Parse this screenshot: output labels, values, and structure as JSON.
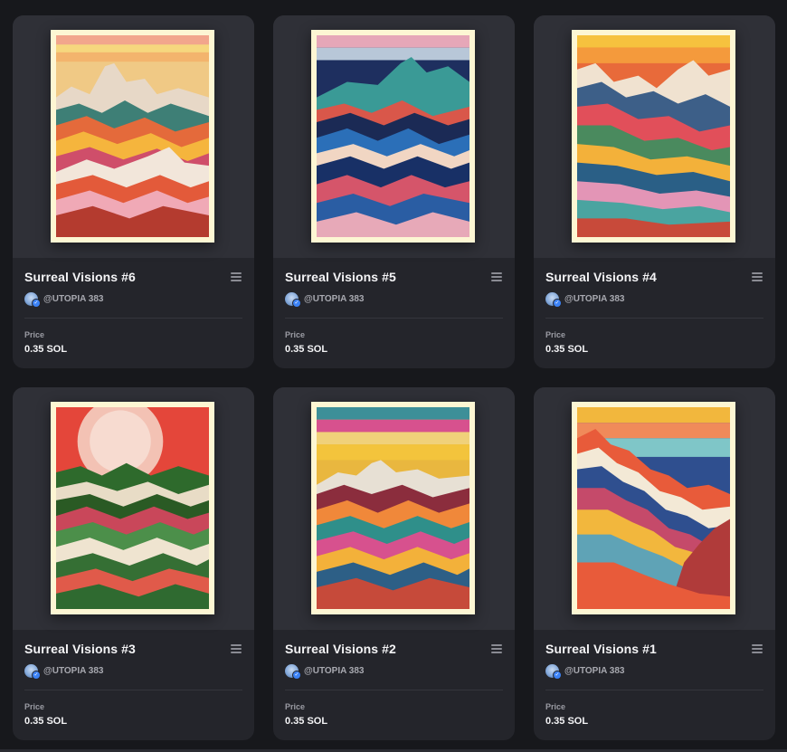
{
  "cards": [
    {
      "title": "Surreal Visions #6",
      "author": "@UTOPIA 383",
      "price_label": "Price",
      "price": "0.35 SOL",
      "palette": [
        "#f4c36b",
        "#e8593a",
        "#3f7a6a",
        "#e9a8b8",
        "#f7f0e0",
        "#243b6e"
      ]
    },
    {
      "title": "Surreal Visions #5",
      "author": "@UTOPIA 383",
      "price_label": "Price",
      "price": "0.35 SOL",
      "palette": [
        "#e9a4b6",
        "#2f8f8d",
        "#d9574a",
        "#1d3163",
        "#2a65b0",
        "#f0d7c6"
      ]
    },
    {
      "title": "Surreal Visions #4",
      "author": "@UTOPIA 383",
      "price_label": "Price",
      "price": "0.35 SOL",
      "palette": [
        "#f7b43a",
        "#e35a3a",
        "#4a8a5e",
        "#e2a0bf",
        "#2a4f80",
        "#f2e6d2"
      ]
    },
    {
      "title": "Surreal Visions #3",
      "author": "@UTOPIA 383",
      "price_label": "Price",
      "price": "0.35 SOL",
      "palette": [
        "#e7493b",
        "#f5c1b6",
        "#2f6d2c",
        "#c24a5c",
        "#e6d7c0",
        "#4c8f4a"
      ]
    },
    {
      "title": "Surreal Visions #2",
      "author": "@UTOPIA 383",
      "price_label": "Price",
      "price": "0.35 SOL",
      "palette": [
        "#e9b73f",
        "#d7518e",
        "#2f8f8a",
        "#8b2d3d",
        "#f0883a",
        "#e7e0d4"
      ]
    },
    {
      "title": "Surreal Visions #1",
      "author": "@UTOPIA 383",
      "price_label": "Price",
      "price": "0.35 SOL",
      "palette": [
        "#f2b73d",
        "#6fc0c6",
        "#2f4f8f",
        "#e85b3a",
        "#c54a6a",
        "#f3e9d6"
      ]
    }
  ]
}
